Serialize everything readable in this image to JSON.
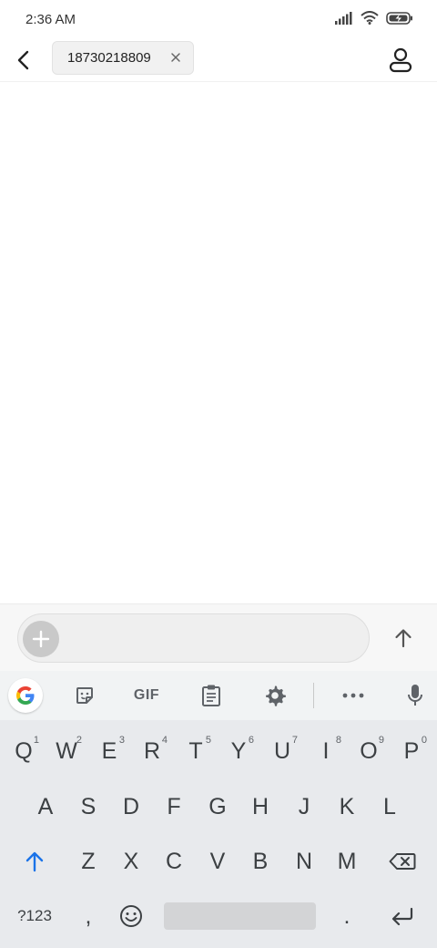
{
  "status_bar": {
    "time": "2:36 AM",
    "icons": [
      "signal-icon",
      "wifi-icon",
      "battery-charging-icon"
    ]
  },
  "header": {
    "recipient_chip": "18730218809",
    "back_icon": "back-arrow-icon",
    "close_icon": "close-icon",
    "contact_icon": "person-icon"
  },
  "compose": {
    "input_value": "",
    "add_icon": "plus-icon",
    "send_icon": "arrow-up-icon"
  },
  "keyboard_toolbar": {
    "gif_label": "GIF",
    "icons": [
      "google-icon",
      "sticker-icon",
      "clipboard-icon",
      "gear-icon",
      "more-icon",
      "mic-icon"
    ]
  },
  "keyboard": {
    "row1": [
      "Q",
      "W",
      "E",
      "R",
      "T",
      "Y",
      "U",
      "I",
      "O",
      "P"
    ],
    "row1_hints": [
      "1",
      "2",
      "3",
      "4",
      "5",
      "6",
      "7",
      "8",
      "9",
      "0"
    ],
    "row2": [
      "A",
      "S",
      "D",
      "F",
      "G",
      "H",
      "J",
      "K",
      "L"
    ],
    "row3": [
      "Z",
      "X",
      "C",
      "V",
      "B",
      "N",
      "M"
    ],
    "symbols_label": "?123",
    "comma": ",",
    "period": "."
  },
  "colors": {
    "accent": "#1a73e8",
    "key_text": "#3c4043",
    "toolbar_icon": "#5f6368"
  }
}
